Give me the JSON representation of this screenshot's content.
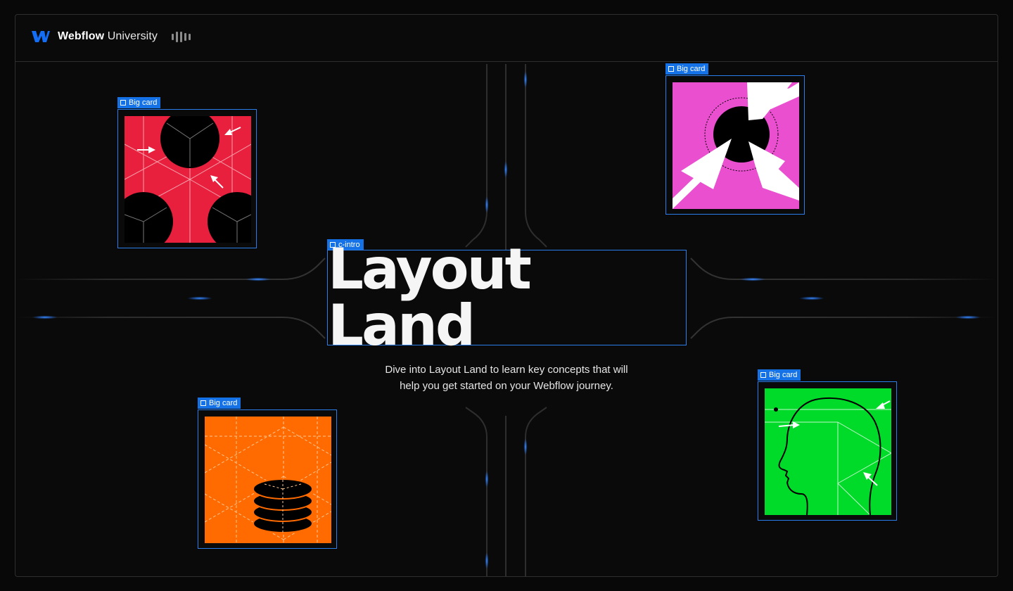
{
  "brand": {
    "name_bold": "Webflow",
    "name_regular": "University",
    "logo_icon": "webflow-logo-icon",
    "logo_color": "#146ef5",
    "menu_icon": "audio-bars-icon"
  },
  "intro": {
    "tag": "c-intro",
    "title": "Layout Land",
    "description": "Dive into Layout Land to learn key concepts that will help you get started on your Webflow journey."
  },
  "cards": [
    {
      "tag": "Big card",
      "color": "#e8203d",
      "illustration": "circles-arrows"
    },
    {
      "tag": "Big card",
      "color": "#ea4fcf",
      "illustration": "target-arrows"
    },
    {
      "tag": "Big card",
      "color": "#ff6b00",
      "illustration": "stacked-discs"
    },
    {
      "tag": "Big card",
      "color": "#00db29",
      "illustration": "head-profile"
    }
  ],
  "colors": {
    "accent": "#1472e6",
    "background": "#0a0a0a",
    "track_glow": "#1e74ff"
  }
}
